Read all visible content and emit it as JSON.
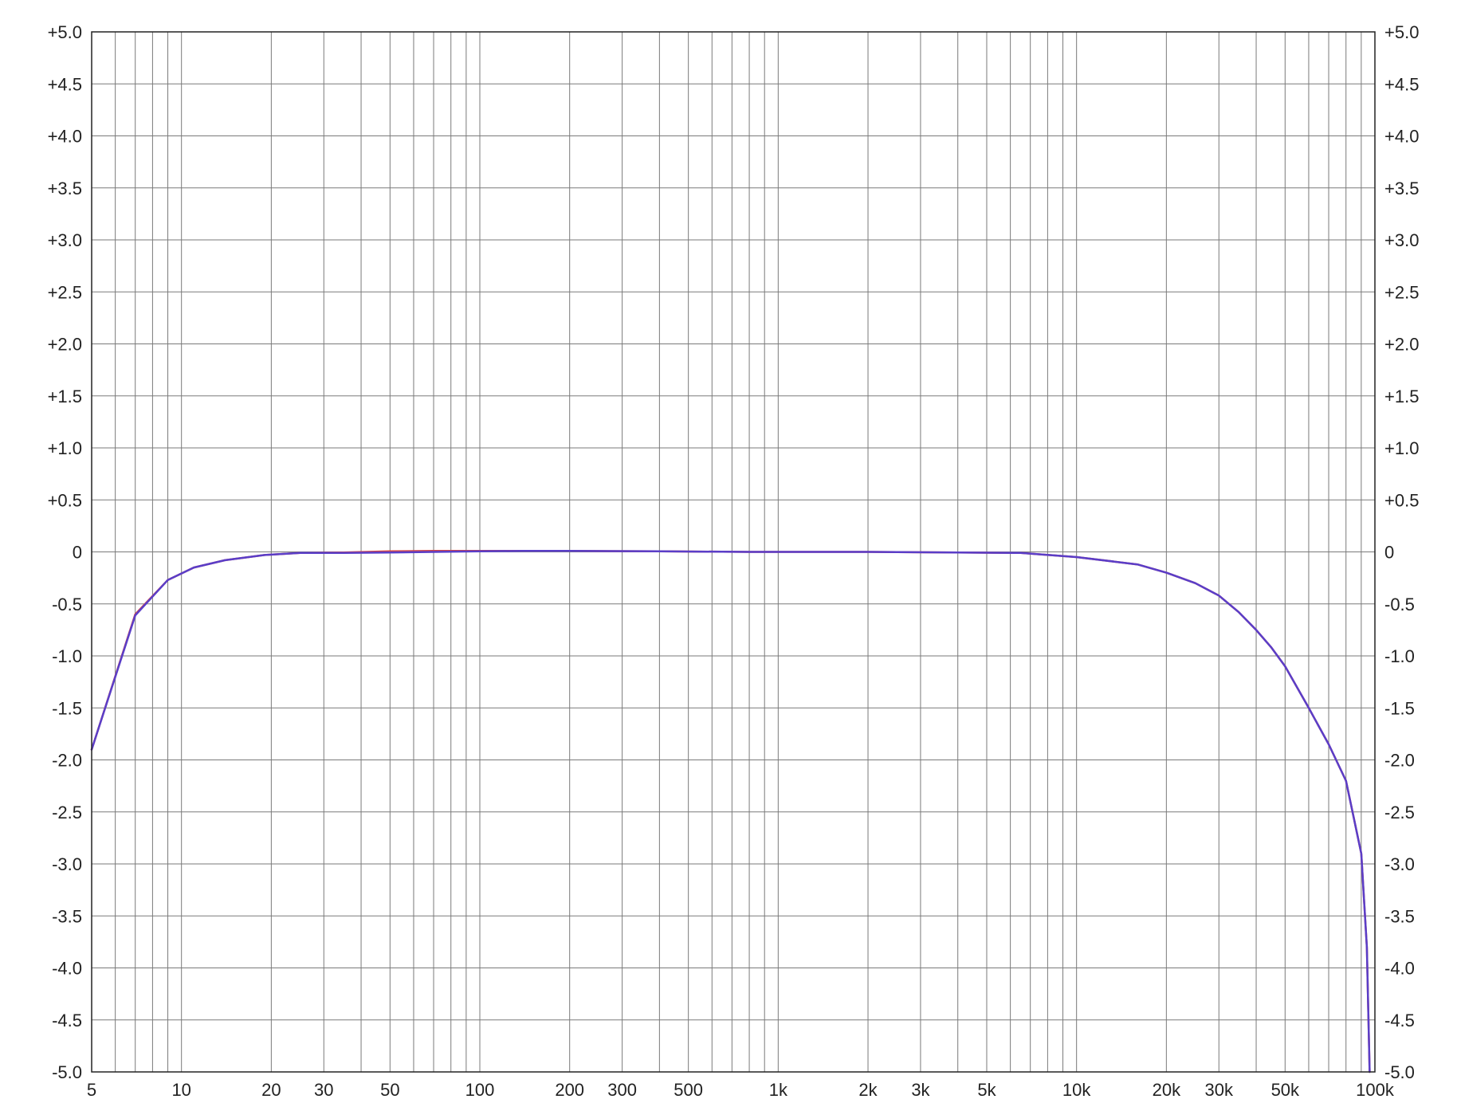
{
  "chart_data": {
    "type": "line",
    "title": "",
    "xlabel": "",
    "ylabel": "",
    "x_scale": "log",
    "xlim": [
      5,
      100000
    ],
    "ylim": [
      -5.0,
      5.0
    ],
    "grid": true,
    "x_major_ticks": [
      5,
      10,
      20,
      30,
      50,
      100,
      200,
      300,
      500,
      1000,
      2000,
      3000,
      5000,
      10000,
      20000,
      30000,
      50000,
      100000
    ],
    "x_tick_labels": [
      "5",
      "10",
      "20",
      "30",
      "50",
      "100",
      "200",
      "300",
      "500",
      "1k",
      "2k",
      "3k",
      "5k",
      "10k",
      "20k",
      "30k",
      "50k",
      "100k"
    ],
    "x_minor_ticks": [
      6,
      7,
      8,
      9,
      40,
      60,
      70,
      80,
      90,
      400,
      600,
      700,
      800,
      900,
      4000,
      6000,
      7000,
      8000,
      9000,
      40000,
      60000,
      70000,
      80000,
      90000
    ],
    "y_ticks": [
      5.0,
      4.5,
      4.0,
      3.5,
      3.0,
      2.5,
      2.0,
      1.5,
      1.0,
      0.5,
      0,
      -0.5,
      -1.0,
      -1.5,
      -2.0,
      -2.5,
      -3.0,
      -3.5,
      -4.0,
      -4.5,
      -5.0
    ],
    "y_tick_labels_left": [
      "+5.0",
      "+4.5",
      "+4.0",
      "+3.5",
      "+3.0",
      "+2.5",
      "+2.0",
      "+1.5",
      "+1.0",
      "+0.5",
      "0",
      "-0.5",
      "-1.0",
      "-1.5",
      "-2.0",
      "-2.5",
      "-3.0",
      "-3.5",
      "-4.0",
      "-4.5",
      "-5.0"
    ],
    "y_tick_labels_right": [
      "+5.0",
      "+4.5",
      "+4.0",
      "+3.5",
      "+3.0",
      "+2.5",
      "+2.0",
      "+1.5",
      "+1.0",
      "+0.5",
      "0",
      "-0.5",
      "-1.0",
      "-1.5",
      "-2.0",
      "-2.5",
      "-3.0",
      "-3.5",
      "-4.0",
      "-4.5",
      "-5.0"
    ],
    "series": [
      {
        "color": "#d64545",
        "x": [
          5,
          7,
          9,
          11,
          14,
          19,
          25,
          35,
          50,
          70,
          100,
          140,
          200,
          400,
          800,
          2000,
          4000,
          6500,
          10000,
          16000,
          20000,
          25000,
          30000,
          35000,
          40000,
          45000,
          50000,
          60000,
          70000,
          80000,
          90000,
          94000,
          96000
        ],
        "y": [
          -1.9,
          -0.6,
          -0.27,
          -0.15,
          -0.08,
          -0.03,
          -0.01,
          -0.005,
          0.005,
          0.01,
          0.01,
          0.01,
          0.01,
          0.005,
          0.0,
          0.0,
          -0.005,
          -0.01,
          -0.05,
          -0.12,
          -0.2,
          -0.3,
          -0.42,
          -0.58,
          -0.75,
          -0.92,
          -1.1,
          -1.5,
          -1.85,
          -2.2,
          -2.9,
          -3.8,
          -5.0
        ]
      },
      {
        "color": "#5a3ec8",
        "x": [
          5,
          7,
          9,
          11,
          14,
          19,
          25,
          35,
          50,
          70,
          100,
          140,
          200,
          400,
          800,
          2000,
          4000,
          6500,
          10000,
          16000,
          20000,
          25000,
          30000,
          35000,
          40000,
          45000,
          50000,
          60000,
          70000,
          80000,
          90000,
          94000,
          96000
        ],
        "y": [
          -1.9,
          -0.61,
          -0.27,
          -0.15,
          -0.08,
          -0.03,
          -0.01,
          -0.01,
          -0.005,
          0.0,
          0.005,
          0.01,
          0.01,
          0.005,
          0.0,
          0.0,
          -0.005,
          -0.01,
          -0.05,
          -0.12,
          -0.2,
          -0.3,
          -0.42,
          -0.58,
          -0.75,
          -0.92,
          -1.1,
          -1.5,
          -1.85,
          -2.2,
          -2.9,
          -3.8,
          -5.0
        ]
      }
    ]
  }
}
